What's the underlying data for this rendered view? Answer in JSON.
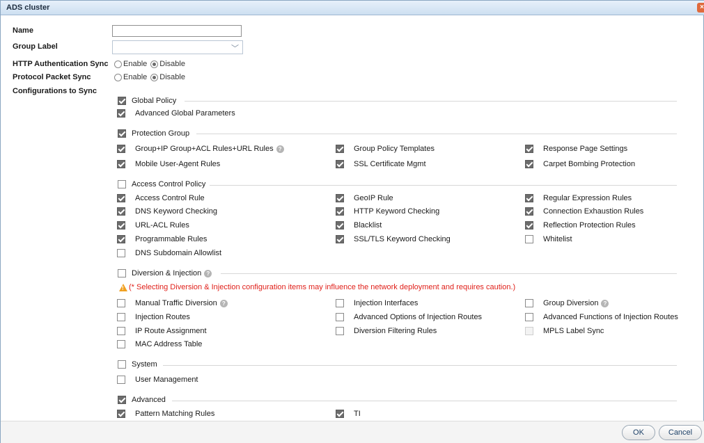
{
  "window": {
    "title": "ADS cluster",
    "close_icon": "close-icon"
  },
  "form": {
    "name_label": "Name",
    "name_value": "",
    "group_label_label": "Group Label",
    "group_label_value": "",
    "http_sync_label": "HTTP Authentication Sync",
    "http_sync_options": [
      "Enable",
      "Disable"
    ],
    "http_sync_selected": "Disable",
    "protocol_sync_label": "Protocol Packet Sync",
    "protocol_sync_options": [
      "Enable",
      "Disable"
    ],
    "protocol_sync_selected": "Disable",
    "configs_label": "Configurations to Sync"
  },
  "sections": {
    "global_policy": {
      "title": "Global Policy",
      "checked": true,
      "items": [
        {
          "label": "Advanced Global Parameters",
          "checked": true
        }
      ]
    },
    "protection_group": {
      "title": "Protection Group",
      "checked": true,
      "items": [
        {
          "label": "Group+IP Group+ACL Rules+URL Rules",
          "checked": true,
          "help": true
        },
        {
          "label": "Group Policy Templates",
          "checked": true
        },
        {
          "label": "Response Page Settings",
          "checked": true
        },
        {
          "label": "Mobile User-Agent Rules",
          "checked": true
        },
        {
          "label": "SSL Certificate Mgmt",
          "checked": true
        },
        {
          "label": "Carpet Bombing Protection",
          "checked": true
        }
      ]
    },
    "access_control": {
      "title": "Access Control Policy",
      "checked": false,
      "items": [
        {
          "label": "Access Control Rule",
          "checked": true
        },
        {
          "label": "GeoIP Rule",
          "checked": true
        },
        {
          "label": "Regular Expression Rules",
          "checked": true
        },
        {
          "label": "DNS Keyword Checking",
          "checked": true
        },
        {
          "label": "HTTP Keyword Checking",
          "checked": true
        },
        {
          "label": "Connection Exhaustion Rules",
          "checked": true
        },
        {
          "label": "URL-ACL Rules",
          "checked": true
        },
        {
          "label": "Blacklist",
          "checked": true
        },
        {
          "label": "Reflection Protection Rules",
          "checked": true
        },
        {
          "label": "Programmable Rules",
          "checked": true
        },
        {
          "label": "SSL/TLS Keyword Checking",
          "checked": true
        },
        {
          "label": "Whitelist",
          "checked": false
        },
        {
          "label": "DNS Subdomain Allowlist",
          "checked": false
        }
      ]
    },
    "diversion": {
      "title": "Diversion & Injection",
      "checked": false,
      "help": true,
      "warning": "(* Selecting Diversion & Injection configuration items may influence the network deployment and requires caution.)",
      "items": [
        {
          "label": "Manual Traffic Diversion",
          "checked": false,
          "help": true
        },
        {
          "label": "Injection Interfaces",
          "checked": false
        },
        {
          "label": "Group Diversion",
          "checked": false,
          "help": true
        },
        {
          "label": "Injection Routes",
          "checked": false
        },
        {
          "label": "Advanced Options of Injection Routes",
          "checked": false
        },
        {
          "label": "Advanced Functions of Injection Routes",
          "checked": false
        },
        {
          "label": "IP Route Assignment",
          "checked": false
        },
        {
          "label": "Diversion Filtering Rules",
          "checked": false
        },
        {
          "label": "MPLS Label Sync",
          "checked": false,
          "disabled": true
        },
        {
          "label": "MAC Address Table",
          "checked": false
        }
      ]
    },
    "system": {
      "title": "System",
      "checked": false,
      "items": [
        {
          "label": "User Management",
          "checked": false
        }
      ]
    },
    "advanced": {
      "title": "Advanced",
      "checked": true,
      "items": [
        {
          "label": "Pattern Matching Rules",
          "checked": true
        },
        {
          "label": "TI",
          "checked": true
        }
      ]
    }
  },
  "buttons": {
    "ok": "OK",
    "cancel": "Cancel"
  },
  "colors": {
    "accent": "#1c3f66",
    "warning_text": "#e0201a",
    "warning_icon": "#f0a020",
    "checkbox_checked": "#6c6c6c"
  }
}
